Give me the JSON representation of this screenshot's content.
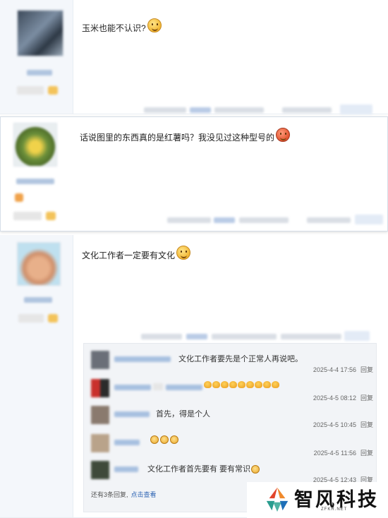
{
  "posts": [
    {
      "text": "玉米也能不认识?",
      "emoji": "smile-emoji"
    },
    {
      "text": "话说图里的东西真的是红薯吗？我没见过这种型号的",
      "emoji": "angry-emoji"
    },
    {
      "text": "文化工作者一定要有文化",
      "emoji": "smile-emoji"
    }
  ],
  "sub_replies": [
    {
      "text": "文化工作者要先是个正常人再说吧。",
      "time": "2025-4-4 17:56",
      "reply": "回复"
    },
    {
      "text": "",
      "emoji_count": 9,
      "time": "2025-4-5 08:12",
      "reply": "回复"
    },
    {
      "text": "首先，得是个人",
      "time": "2025-4-5 10:45",
      "reply": "回复"
    },
    {
      "text": "",
      "face_emoji_count": 3,
      "time": "2025-4-5 11:56",
      "reply": "回复"
    },
    {
      "text": "文化工作者首先要有 要有常识",
      "time": "2025-4-5 12:43",
      "reply": "回复"
    }
  ],
  "more": {
    "text": "还有3条回复,",
    "link": "点击查看"
  },
  "watermark": {
    "name": "智风科技",
    "sub": "ZFKR.NET"
  }
}
